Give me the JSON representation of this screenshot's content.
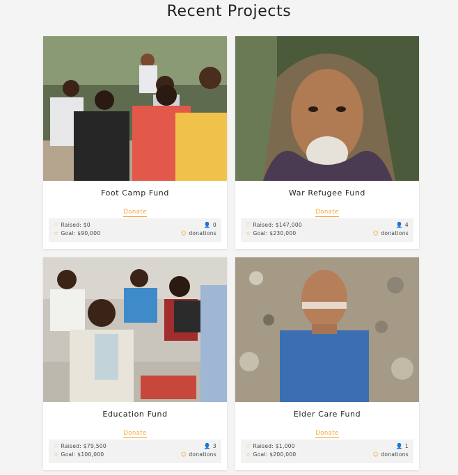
{
  "page": {
    "title": "Recent Projects"
  },
  "accent_color": "#f3a73b",
  "projects": [
    {
      "title": "Foot Camp Fund",
      "donate_label": "Donate",
      "raised": "Raised: $0",
      "goal": "Goal: $90,000",
      "donors": "0",
      "donations_label": "donations",
      "image": "children-sitting-outdoors-photo"
    },
    {
      "title": "War Refugee Fund",
      "donate_label": "Donate",
      "raised": "Raised: $147,000",
      "goal": "Goal: $230,000",
      "donors": "4",
      "donations_label": "donations",
      "image": "elderly-man-headscarf-photo"
    },
    {
      "title": "Education Fund",
      "donate_label": "Donate",
      "raised": "Raised: $79,500",
      "goal": "Goal: $100,000",
      "donors": "3",
      "donations_label": "donations",
      "image": "children-classroom-slates-photo"
    },
    {
      "title": "Elder Care Fund",
      "donate_label": "Donate",
      "raised": "Raised: $1,000",
      "goal": "Goal: $200,000",
      "donors": "1",
      "donations_label": "donations",
      "image": "smiling-boy-rocks-photo"
    }
  ],
  "icons": {
    "raised": "heart-icon",
    "goal": "star-icon",
    "donors": "user-icon",
    "donations": "smiley-icon"
  }
}
